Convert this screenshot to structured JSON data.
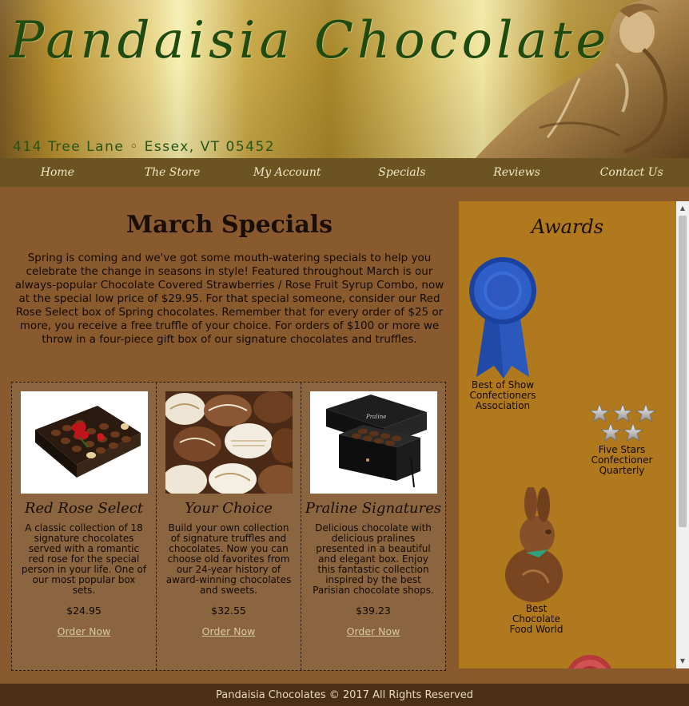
{
  "header": {
    "title": "Pandaisia Chocolates",
    "address": "414 Tree Lane ◦ Essex, VT 05452"
  },
  "nav": [
    {
      "label": "Home"
    },
    {
      "label": "The Store"
    },
    {
      "label": "My Account"
    },
    {
      "label": "Specials"
    },
    {
      "label": "Reviews"
    },
    {
      "label": "Contact Us"
    }
  ],
  "main": {
    "title": "March Specials",
    "intro": "Spring is coming and we've got some mouth-watering specials to help you celebrate the change in seasons in style! Featured throughout March is our always-popular Chocolate Covered Strawberries / Rose Fruit Syrup Combo, now at the special low price of $29.95. For that special someone, consider our Red Rose Select box of Spring chocolates. Remember that for every order of $25 or more, you receive a free truffle of your choice. For orders of $100 or more we throw in a four-piece gift box of our signature chocolates and truffles.",
    "products": [
      {
        "name": "Red Rose Select",
        "description": "A classic collection of 18 signature chocolates served with a romantic red rose for the special person in your life. One of our most popular box sets.",
        "price": "$24.95",
        "order_label": "Order Now"
      },
      {
        "name": "Your Choice",
        "description": "Build your own collection of signature truffles and chocolates. Now you can choose old favorites from our 24-year history of award-winning chocolates and sweets.",
        "price": "$32.55",
        "order_label": "Order Now"
      },
      {
        "name": "Praline Signatures",
        "description": "Delicious chocolate with delicious pralines presented in a beautiful and elegant box. Enjoy this fantastic collection inspired by the best Parisian chocolate shops.",
        "price": "$39.23",
        "order_label": "Order Now"
      }
    ]
  },
  "sidebar": {
    "title": "Awards",
    "awards": [
      {
        "caption": "Best of Show\nConfectioners\nAssociation"
      },
      {
        "caption": "Five Stars\nConfectioner\nQuarterly"
      },
      {
        "caption": "Best\nChocolate\nFood World"
      }
    ]
  },
  "footer": {
    "text": "Pandaisia Chocolates © 2017 All Rights Reserved"
  },
  "colors": {
    "title_green": "#1f4a10",
    "nav_bg": "#6b5422",
    "main_bg": "#885a2e",
    "sidebar_bg": "#b0791e",
    "footer_bg": "#4a2f16",
    "ribbon_blue": "#1f4aa8"
  }
}
